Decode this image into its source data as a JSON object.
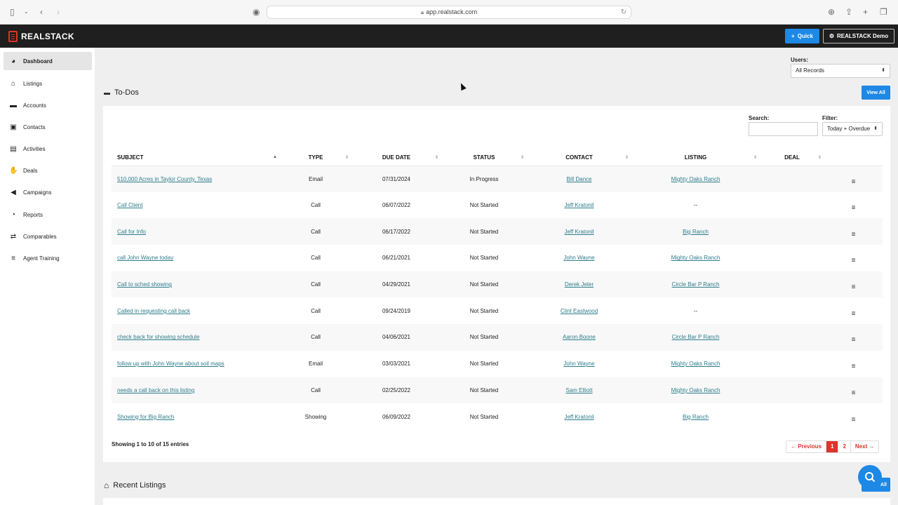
{
  "browser": {
    "url": "app.realstack.com"
  },
  "header": {
    "brand": "REALSTACK",
    "quick_label": "Quick",
    "account_label": "REALSTACK Demo"
  },
  "sidebar": {
    "items": [
      {
        "label": "Dashboard",
        "icon": "dashboard-icon",
        "active": true
      },
      {
        "label": "Listings",
        "icon": "home-icon"
      },
      {
        "label": "Accounts",
        "icon": "briefcase-icon"
      },
      {
        "label": "Contacts",
        "icon": "contact-card-icon"
      },
      {
        "label": "Activities",
        "icon": "calendar-icon"
      },
      {
        "label": "Deals",
        "icon": "handshake-icon"
      },
      {
        "label": "Campaigns",
        "icon": "megaphone-icon"
      },
      {
        "label": "Reports",
        "icon": "pie-chart-icon"
      },
      {
        "label": "Comparables",
        "icon": "compare-icon"
      },
      {
        "label": "Agent Training",
        "icon": "list-icon"
      }
    ]
  },
  "users_filter": {
    "label": "Users:",
    "value": "All Records"
  },
  "todos": {
    "title": "To-Dos",
    "view_all": "View All",
    "search_label": "Search:",
    "search_value": "",
    "filter_label": "Filter:",
    "filter_value": "Today + Overdue",
    "columns": [
      "SUBJECT",
      "TYPE",
      "DUE DATE",
      "STATUS",
      "CONTACT",
      "LISTING",
      "DEAL"
    ],
    "rows": [
      {
        "subject": "510,000 Acres in Taylor County, Texas",
        "type": "Email",
        "due": "07/31/2024",
        "status": "In Progress",
        "contact": "Bill Dance",
        "listing": "Mighty Oaks Ranch"
      },
      {
        "subject": "Call Client",
        "type": "Call",
        "due": "06/07/2022",
        "status": "Not Started",
        "contact": "Jeff Kratonil",
        "listing": "--"
      },
      {
        "subject": "Call for Info",
        "type": "Call",
        "due": "06/17/2022",
        "status": "Not Started",
        "contact": "Jeff Kratonil",
        "listing": "Big Ranch"
      },
      {
        "subject": "call John Wayne today",
        "type": "Call",
        "due": "06/21/2021",
        "status": "Not Started",
        "contact": "John Wayne",
        "listing": "Mighty Oaks Ranch"
      },
      {
        "subject": "Call to sched showing",
        "type": "Call",
        "due": "04/29/2021",
        "status": "Not Started",
        "contact": "Derek Jeter",
        "listing": "Circle Bar P Ranch"
      },
      {
        "subject": "Called in requesting call back",
        "type": "Call",
        "due": "09/24/2019",
        "status": "Not Started",
        "contact": "Clint Eastwood",
        "listing": "--"
      },
      {
        "subject": "check back for showing schedule",
        "type": "Call",
        "due": "04/06/2021",
        "status": "Not Started",
        "contact": "Aaron Boone",
        "listing": "Circle Bar P Ranch"
      },
      {
        "subject": "follow up with John Wayne about soil maps",
        "type": "Email",
        "due": "03/03/2021",
        "status": "Not Started",
        "contact": "John Wayne",
        "listing": "Mighty Oaks Ranch"
      },
      {
        "subject": "needs a call back on this listing",
        "type": "Call",
        "due": "02/25/2022",
        "status": "Not Started",
        "contact": "Sam Elliott",
        "listing": "Mighty Oaks Ranch"
      },
      {
        "subject": "Showing for Big Ranch",
        "type": "Showing",
        "due": "06/09/2022",
        "status": "Not Started",
        "contact": "Jeff Kratonil",
        "listing": "Big Ranch"
      }
    ],
    "entries_text": "Showing 1 to 10 of 15 entries",
    "pagination": {
      "previous": "← Previous",
      "pages": [
        "1",
        "2"
      ],
      "current": "1",
      "next": "Next →"
    }
  },
  "recent_listings": {
    "title": "Recent Listings",
    "view_all_partial": "All"
  },
  "colors": {
    "accent": "#1e88e5",
    "brand_red": "#e0332c",
    "link": "#2e7d8c",
    "header_bg": "#1f1f1f"
  }
}
